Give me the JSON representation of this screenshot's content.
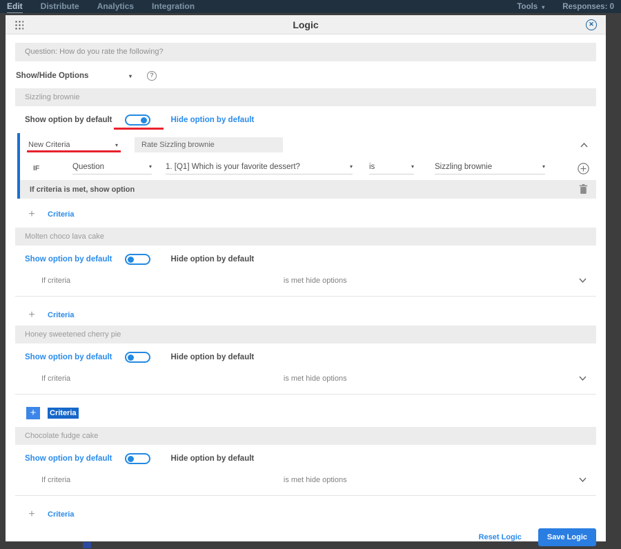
{
  "topbar": {
    "tabs": [
      {
        "label": "Edit",
        "active": true
      },
      {
        "label": "Distribute",
        "active": false
      },
      {
        "label": "Analytics",
        "active": false
      },
      {
        "label": "Integration",
        "active": false
      }
    ],
    "tools_label": "Tools",
    "responses_label": "Responses: 0"
  },
  "modal": {
    "title": "Logic",
    "question_bar": "Question: How do you rate the following?",
    "logic_type_dropdown": "Show/Hide Options",
    "footer": {
      "reset_label": "Reset Logic",
      "save_label": "Save Logic"
    }
  },
  "labels": {
    "show_default": "Show option by default",
    "hide_default": "Hide option by default",
    "add_criteria": "Criteria",
    "collapsed_left": "If criteria",
    "collapsed_mid": "is met hide options"
  },
  "sections": [
    {
      "name": "Sizzling brownie",
      "toggle_state": "hide-side",
      "expanded": true,
      "criteria": {
        "criteria_dropdown": "New Criteria",
        "criteria_name_input": "Rate Sizzling brownie",
        "if_label": "IF",
        "type_dropdown": "Question",
        "question_dropdown": "1. [Q1] Which is your favorite dessert?",
        "operator_dropdown": "is",
        "value_dropdown": "Sizzling brownie",
        "action_text": "If criteria is met, show option"
      }
    },
    {
      "name": "Molten choco lava cake",
      "toggle_state": "show-side",
      "expanded": false
    },
    {
      "name": "Honey sweetened cherry pie",
      "toggle_state": "show-side",
      "expanded": false,
      "add_criteria_highlighted": true
    },
    {
      "name": "Chocolate fudge cake",
      "toggle_state": "show-side",
      "expanded": false
    }
  ],
  "colors": {
    "accent_blue": "#2289e3",
    "link_blue": "#2a8bea",
    "annotation_red": "#e8212c",
    "topbar_bg": "#20303f",
    "criteria_border_blue": "#1a70cf"
  }
}
